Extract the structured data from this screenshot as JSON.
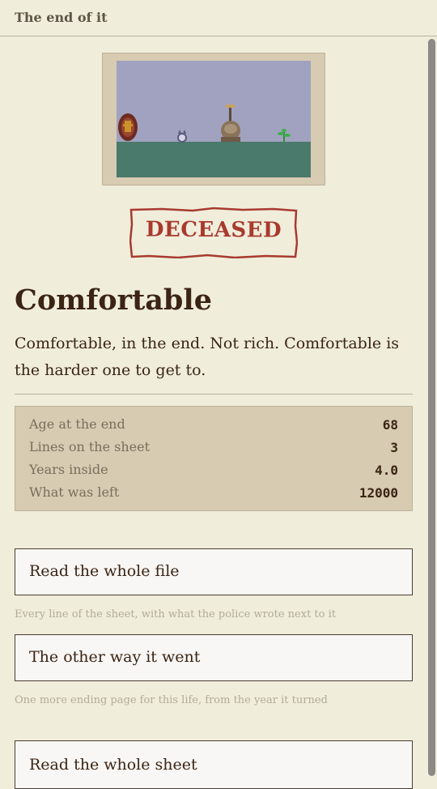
{
  "header": {
    "title": "The end of it"
  },
  "scene": {
    "sky_color": "#a0a2bf",
    "ground_color": "#4a7a6c",
    "figures": [
      "coffin-icon",
      "cat-icon",
      "shovel-and-sack-icon",
      "weed-icon"
    ]
  },
  "stamp": {
    "text": "DECEASED",
    "color": "#a83a2e"
  },
  "ending": {
    "title": "Comfortable",
    "summary": "Comfortable, in the end. Not rich. Comfortable is the harder one to get to."
  },
  "stats": [
    {
      "label": "Age at the end",
      "value": "68"
    },
    {
      "label": "Lines on the sheet",
      "value": "3"
    },
    {
      "label": "Years inside",
      "value": "4.0"
    },
    {
      "label": "What was left",
      "value": "12000"
    }
  ],
  "actions": [
    {
      "label": "Read the whole file",
      "caption": "Every line of the sheet, with what the police wrote next to it"
    },
    {
      "label": "The other way it went",
      "caption": "One more ending page for this life, from the year it turned"
    },
    {
      "label": "Read the whole sheet",
      "caption": ""
    }
  ]
}
